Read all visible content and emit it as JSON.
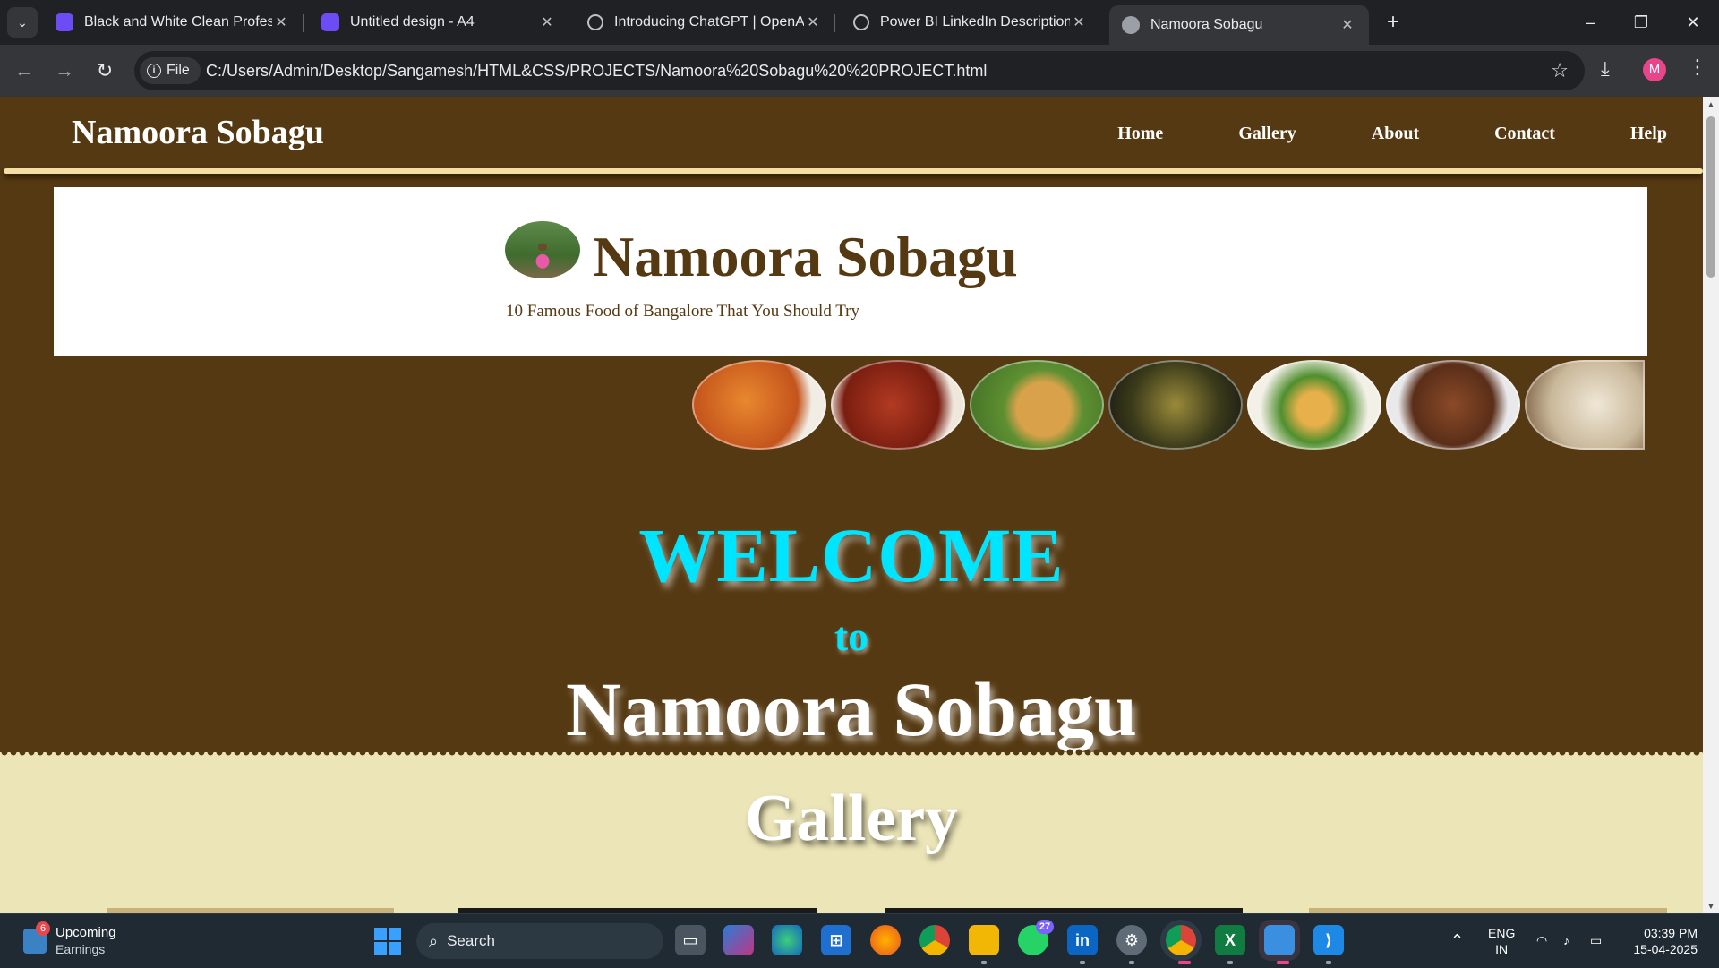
{
  "browser": {
    "tabs": [
      {
        "title": "Black and White Clean Professio",
        "favicon": "canva-icon",
        "color": "#6e4cf5",
        "active": false
      },
      {
        "title": "Untitled design - A4",
        "favicon": "canva-icon",
        "color": "#6e4cf5",
        "active": false
      },
      {
        "title": "Introducing ChatGPT | OpenAI",
        "favicon": "openai-icon",
        "color": "#202124",
        "active": false
      },
      {
        "title": "Power BI LinkedIn Description",
        "favicon": "openai-icon",
        "color": "#202124",
        "active": false
      },
      {
        "title": "Namoora Sobagu",
        "favicon": "globe-icon",
        "color": "#9aa0a6",
        "active": true
      }
    ],
    "new_tab": "+",
    "address": {
      "scheme_chip": "File",
      "url": "C:/Users/Admin/Desktop/Sangamesh/HTML&CSS/PROJECTS/Namoora%20Sobagu%20%20PROJECT.html"
    },
    "profile_initial": "M"
  },
  "site": {
    "brand": "Namoora Sobagu",
    "nav": [
      "Home",
      "Gallery",
      "About",
      "Contact",
      "Help"
    ],
    "hero": {
      "title": "Namoora Sobagu",
      "subtitle": "10 Famous Food of Bangalore That You Should Try"
    },
    "foods": [
      {
        "name": "pasta-dish",
        "color": "#d9702a"
      },
      {
        "name": "chilli-chicken-dish",
        "color": "#a8321e"
      },
      {
        "name": "dosa-dish",
        "color": "#6e9a3a"
      },
      {
        "name": "stuffed-dish",
        "color": "#3a3a1e"
      },
      {
        "name": "thali-dish",
        "color": "#e6b04a"
      },
      {
        "name": "fried-starter-dish",
        "color": "#7a4a2a"
      },
      {
        "name": "rice-dish",
        "color": "#c9b89a"
      }
    ],
    "welcome": {
      "line1": "WELCOME",
      "line2": "to",
      "line3": "Namoora Sobagu"
    },
    "gallery_title": "Gallery",
    "colors": {
      "primary": "#553912",
      "accent": "#00e5ff",
      "cream": "#ece5b8"
    }
  },
  "taskbar": {
    "weather": {
      "title": "Upcoming",
      "sub": "Earnings",
      "badge": "6"
    },
    "search_placeholder": "Search",
    "whatsapp_badge": "27",
    "tray": {
      "lang1": "ENG",
      "lang2": "IN",
      "time": "03:39 PM",
      "date": "15-04-2025"
    }
  }
}
